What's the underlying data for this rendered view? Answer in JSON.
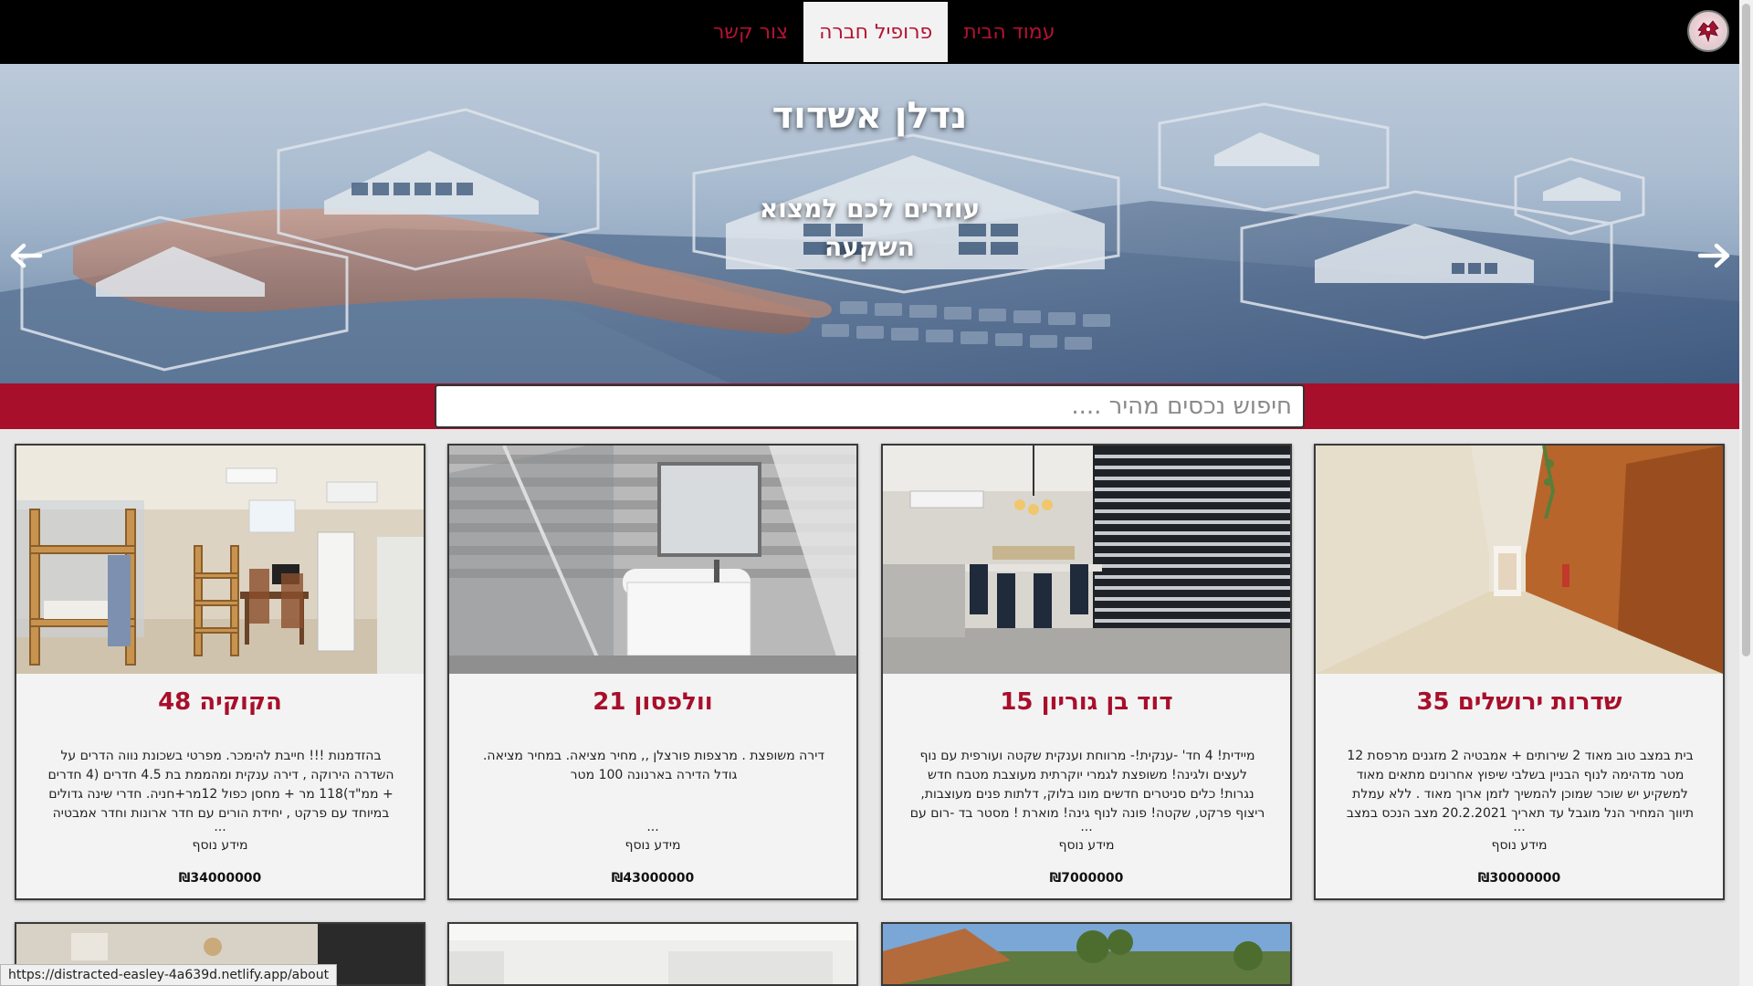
{
  "nav": {
    "items": [
      {
        "label": "עמוד הבית",
        "active": false
      },
      {
        "label": "פרופיל חברה",
        "active": true
      },
      {
        "label": "צור קשר",
        "active": false
      }
    ]
  },
  "hero": {
    "title": "נדלן אשדוד",
    "subtitle": "עוזרים לכם למצוא השקעה"
  },
  "search": {
    "placeholder": "חיפוש נכסים מהיר ...."
  },
  "cards": [
    {
      "title": "שדרות ירושלים 35",
      "description": "בית במצב טוב מאוד 2 שירותים + אמבטיה 2 מזגנים מרפסת 12 מטר מדהימה לנוף הבניין בשלבי שיפוץ אחרונים מתאים מאוד למשקיע יש שוכר שמוכן להמשיך לזמן ארוך מאוד . ללא עמלת תיווך המחיר הנל מוגבל עד תאריך 20.2.2021 מצב הנכס במצב שמור",
      "ellipsis": "...",
      "more": "מידע נוסף",
      "price": "₪30000000"
    },
    {
      "title": "דוד בן גוריון 15",
      "description": "מיידית! 4 חד' -ענקית!- מרווחת וענקית שקטה ועורפית עם נוף לעצים ולגינה! משופצת לגמרי יוקרתית מעוצבת מטבח חדש נגרות! כלים סניטרים חדשים מונו בלוק, דלתות פנים מעוצבות, ריצוף פרקט, שקטה! פונה לנוף גינה! מוארת ! מסטר בד -רום עם חדר ארונות, מקלחת ושירותים, מיזוג בכל",
      "ellipsis": "...",
      "more": "מידע נוסף",
      "price": "₪7000000"
    },
    {
      "title": "וולפסון 21",
      "description": "דירה משופצת . מרצפות פורצלן ,, מחיר מציאה. במחיר מציאה. גודל הדירה בארנונה 100 מטר",
      "ellipsis": "...",
      "more": "מידע נוסף",
      "price": "₪43000000"
    },
    {
      "title": "הקוקיה 48",
      "description": "בהזדמנות !!! חייבת להימכר. מפרטי בשכונת נווה הדרים על השדרה הירוקה , דירה ענקית ומהממת בת 4.5 חדרים (4 חדרים + ממ\"ד)118 מר + מחסן כפול 12מר+חניה. חדרי שינה גדולים במיוחד עם פרקט , יחידת הורים עם חדר ארונות וחדר אמבטיה מפנק .כיוונים צפון מערב .מזגן מיני מרכזי +",
      "ellipsis": "...",
      "more": "מידע נוסף",
      "price": "₪34000000"
    }
  ],
  "statusbar": {
    "url": "https://distracted-easley-4a639d.netlify.app/about"
  },
  "colors": {
    "accent": "#a80f2b",
    "navbar": "#000000",
    "card_bg": "#f3f3f3"
  }
}
